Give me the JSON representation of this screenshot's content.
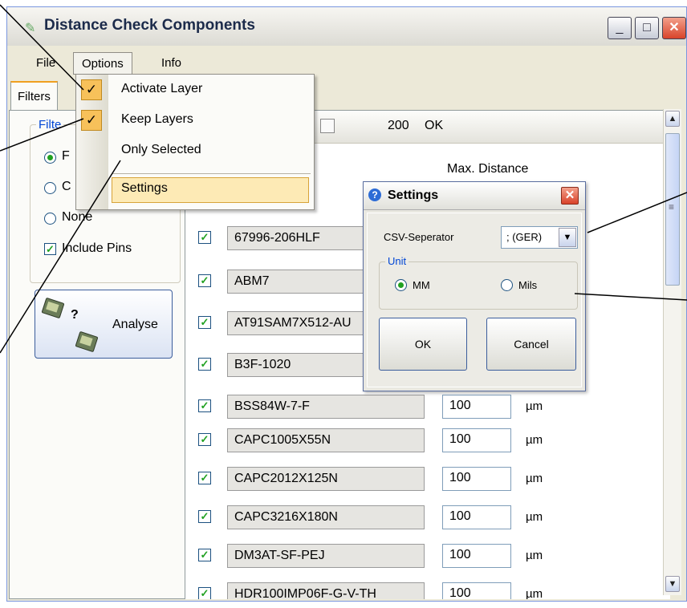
{
  "window": {
    "title": "Distance Check Components",
    "minimize": "_",
    "maximize": "□",
    "close": "✕"
  },
  "menubar": {
    "file": "File",
    "options": "Options",
    "info": "Info"
  },
  "options_menu": {
    "items": [
      {
        "label": "Activate Layer",
        "checked": true
      },
      {
        "label": "Keep Layers",
        "checked": true
      },
      {
        "label": "Only Selected",
        "checked": false
      },
      {
        "label": "Settings",
        "checked": false
      }
    ],
    "check_glyph": "✓"
  },
  "tabs": {
    "filters": "Filters"
  },
  "filter_group": {
    "label": "Filte",
    "options": [
      {
        "label": "F",
        "selected": true
      },
      {
        "label": "C",
        "selected": false
      },
      {
        "label": "None",
        "selected": false
      }
    ],
    "include_pins": {
      "label": "Include Pins",
      "checked": true
    }
  },
  "analyse": {
    "label": "Analyse",
    "qmark": "?"
  },
  "toolbar": {
    "value": "200",
    "ok": "OK"
  },
  "columns": {
    "max_distance": "Max. Distance"
  },
  "components": [
    {
      "name": "67996-206HLF",
      "distance": "",
      "unit": ""
    },
    {
      "name": "ABM7",
      "distance": "",
      "unit": ""
    },
    {
      "name": "AT91SAM7X512-AU",
      "distance": "",
      "unit": ""
    },
    {
      "name": "B3F-1020",
      "distance": "",
      "unit": ""
    },
    {
      "name": "BSS84W-7-F",
      "distance": "100",
      "unit": "µm"
    },
    {
      "name": "CAPC1005X55N",
      "distance": "100",
      "unit": "µm"
    },
    {
      "name": "CAPC2012X125N",
      "distance": "100",
      "unit": "µm"
    },
    {
      "name": "CAPC3216X180N",
      "distance": "100",
      "unit": "µm"
    },
    {
      "name": "DM3AT-SF-PEJ",
      "distance": "100",
      "unit": "µm"
    },
    {
      "name": "HDR100IMP06F-G-V-TH",
      "distance": "100",
      "unit": "µm"
    }
  ],
  "checkmark": "✓",
  "settings_dialog": {
    "title": "Settings",
    "help": "?",
    "close": "✕",
    "csv_label": "CSV-Seperator",
    "csv_value": "; (GER)",
    "dropdown_arrow": "▼",
    "unit_group": "Unit",
    "unit_mm": "MM",
    "unit_mils": "Mils",
    "unit_selected": "MM",
    "ok": "OK",
    "cancel": "Cancel"
  },
  "scrollbar": {
    "up": "▲",
    "down": "▼",
    "grip": "≡"
  },
  "colors": {
    "accent_check": "#f7c15a",
    "menu_hover": "#fdeab5",
    "checkbox_tick": "#21a121",
    "group_label": "#0046d5"
  }
}
